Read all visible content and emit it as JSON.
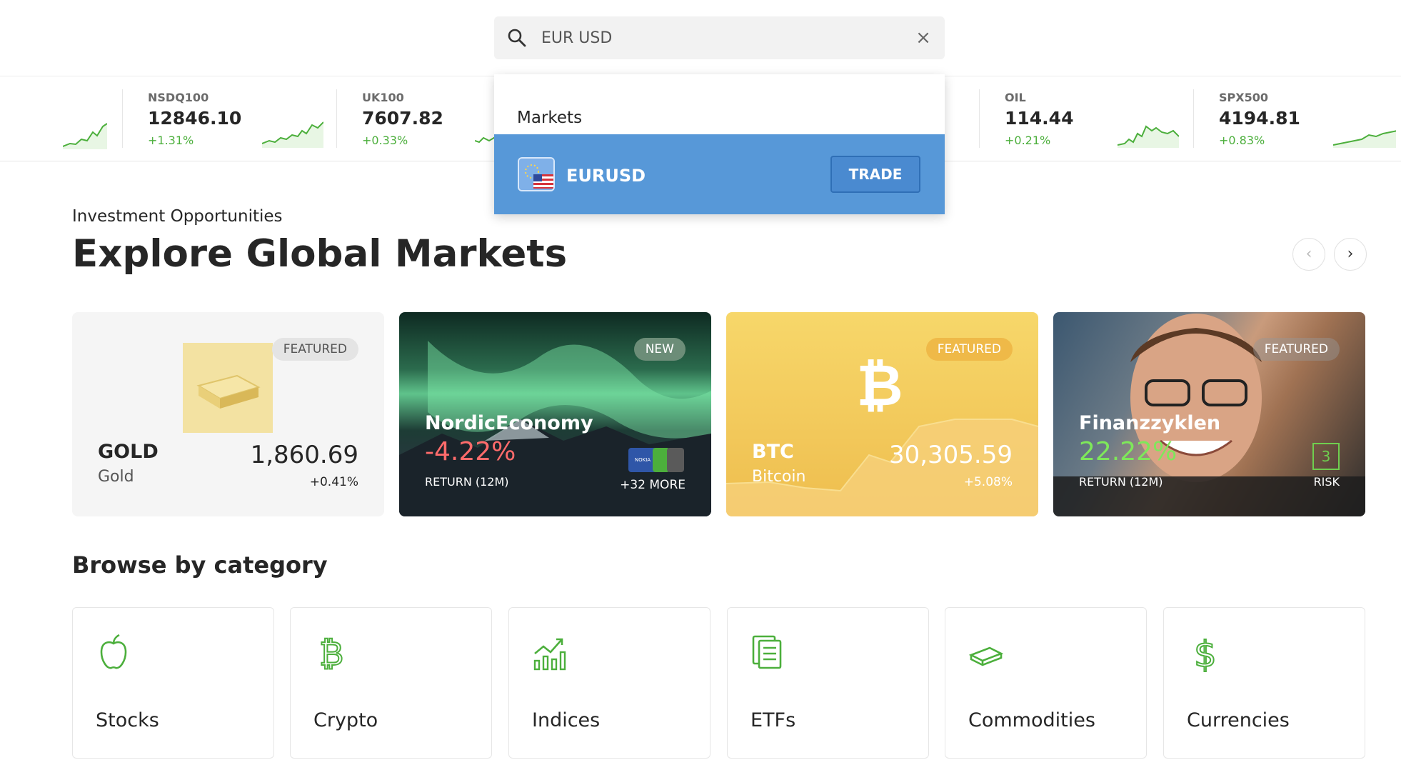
{
  "search": {
    "value": "EUR USD",
    "clear_glyph": "×"
  },
  "ticker": [
    {
      "name": "NSDQ100",
      "price": "12846.10",
      "change": "+1.31%"
    },
    {
      "name": "UK100",
      "price": "7607.82",
      "change": "+0.33%"
    },
    {
      "name": "OIL",
      "price": "114.44",
      "change": "+0.21%"
    },
    {
      "name": "SPX500",
      "price": "4194.81",
      "change": "+0.83%"
    }
  ],
  "dropdown": {
    "section_title": "Markets",
    "result": {
      "symbol": "EURUSD",
      "trade_label": "TRADE"
    }
  },
  "section": {
    "eyebrow": "Investment Opportunities",
    "title": "Explore Global Markets",
    "prev_glyph": "‹",
    "next_glyph": "›"
  },
  "cards": [
    {
      "badge": "FEATURED",
      "name": "GOLD",
      "sub": "Gold",
      "value": "1,860.69",
      "change": "+0.41%"
    },
    {
      "badge": "NEW",
      "name": "NordicEconomy",
      "return": "-4.22%",
      "return_label": "RETURN (12M)",
      "more": "+32 MORE",
      "logo_text": "NOKIA"
    },
    {
      "badge": "FEATURED",
      "name": "BTC",
      "sub": "Bitcoin",
      "value": "30,305.59",
      "change": "+5.08%"
    },
    {
      "badge": "FEATURED",
      "name": "Finanzzyklen",
      "return": "22.22%",
      "return_label": "RETURN (12M)",
      "risk": "3",
      "risk_label": "RISK"
    }
  ],
  "categories": {
    "title": "Browse by category",
    "items": [
      {
        "label": "Stocks",
        "icon": "apple-icon"
      },
      {
        "label": "Crypto",
        "icon": "bitcoin-icon"
      },
      {
        "label": "Indices",
        "icon": "chart-up-icon"
      },
      {
        "label": "ETFs",
        "icon": "documents-icon"
      },
      {
        "label": "Commodities",
        "icon": "gold-bar-icon"
      },
      {
        "label": "Currencies",
        "icon": "dollar-icon"
      }
    ]
  },
  "colors": {
    "accent_blue": "#5798d8",
    "positive_green": "#4caf3c",
    "negative_red": "#ff6b6b"
  }
}
